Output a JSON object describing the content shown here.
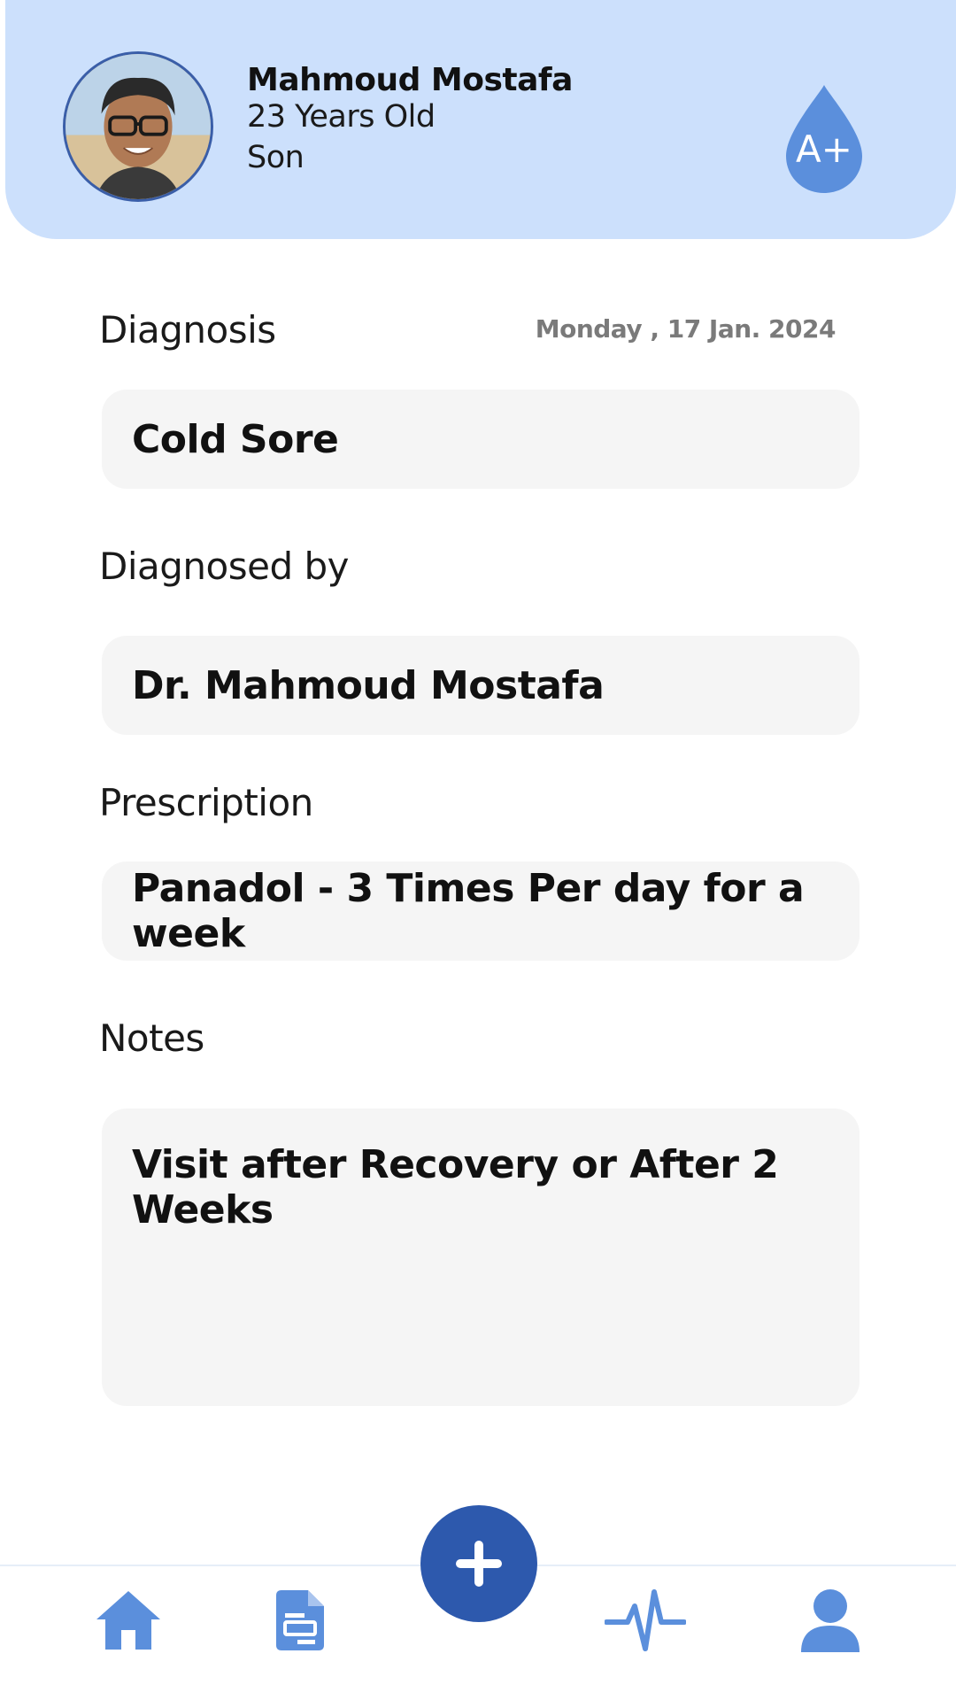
{
  "profile": {
    "name": "Mahmoud Mostafa",
    "age": "23 Years Old",
    "relation": "Son",
    "blood_type": "A+"
  },
  "record": {
    "date": "Monday , 17 Jan. 2024",
    "diagnosis_label": "Diagnosis",
    "diagnosis_value": "Cold Sore",
    "diagnosed_by_label": "Diagnosed by",
    "diagnosed_by_value": "Dr. Mahmoud Mostafa",
    "prescription_label": "Prescription",
    "prescription_value": "Panadol - 3 Times Per day for a week",
    "notes_label": "Notes",
    "notes_value": "Visit after Recovery or After 2 Weeks"
  },
  "nav": {
    "items": [
      {
        "icon": "home-icon"
      },
      {
        "icon": "document-icon"
      },
      {
        "icon": "add-icon"
      },
      {
        "icon": "heartbeat-icon"
      },
      {
        "icon": "profile-icon"
      }
    ]
  },
  "colors": {
    "header_bg": "#cce0fc",
    "accent": "#5b8fdc",
    "fab": "#2d59ad",
    "field_bg": "#f5f5f5"
  }
}
